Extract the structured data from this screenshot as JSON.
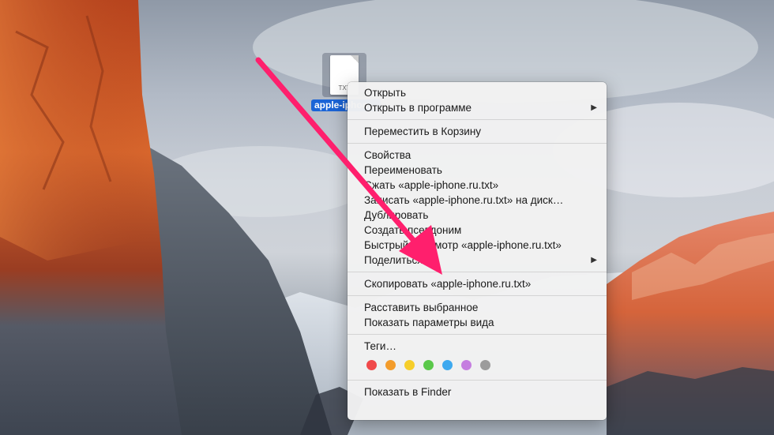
{
  "desktop_file": {
    "extension": "TXT",
    "name": "apple-iphone.ru.txt"
  },
  "context_menu": {
    "groups": [
      [
        {
          "label": "Открыть",
          "submenu": false
        },
        {
          "label": "Открыть в программе",
          "submenu": true
        }
      ],
      [
        {
          "label": "Переместить в Корзину",
          "submenu": false
        }
      ],
      [
        {
          "label": "Свойства",
          "submenu": false
        },
        {
          "label": "Переименовать",
          "submenu": false
        },
        {
          "label": "Сжать «apple-iphone.ru.txt»",
          "submenu": false
        },
        {
          "label": "Записать «apple-iphone.ru.txt» на диск…",
          "submenu": false
        },
        {
          "label": "Дублировать",
          "submenu": false
        },
        {
          "label": "Создать псевдоним",
          "submenu": false
        },
        {
          "label": "Быстрый просмотр «apple-iphone.ru.txt»",
          "submenu": false
        },
        {
          "label": "Поделиться",
          "submenu": true
        }
      ],
      [
        {
          "label": "Скопировать «apple-iphone.ru.txt»",
          "submenu": false
        }
      ],
      [
        {
          "label": "Расставить выбранное",
          "submenu": false
        },
        {
          "label": "Показать параметры вида",
          "submenu": false
        }
      ],
      [
        {
          "label": "Теги…",
          "submenu": false
        }
      ]
    ],
    "submenu_glyph": "▶",
    "tag_colors": [
      {
        "name": "red",
        "color": "#f0494a"
      },
      {
        "name": "orange",
        "color": "#f39c2b"
      },
      {
        "name": "yellow",
        "color": "#f6ce2a"
      },
      {
        "name": "green",
        "color": "#5ac84a"
      },
      {
        "name": "blue",
        "color": "#3da9ef"
      },
      {
        "name": "purple",
        "color": "#c57ee0"
      },
      {
        "name": "gray",
        "color": "#9c9c9c"
      }
    ],
    "footer_item": {
      "label": "Показать в Finder",
      "submenu": false
    }
  },
  "annotation": {
    "arrow_color": "#ff1f6d",
    "points_to": "Скопировать «apple-iphone.ru.txt»"
  }
}
